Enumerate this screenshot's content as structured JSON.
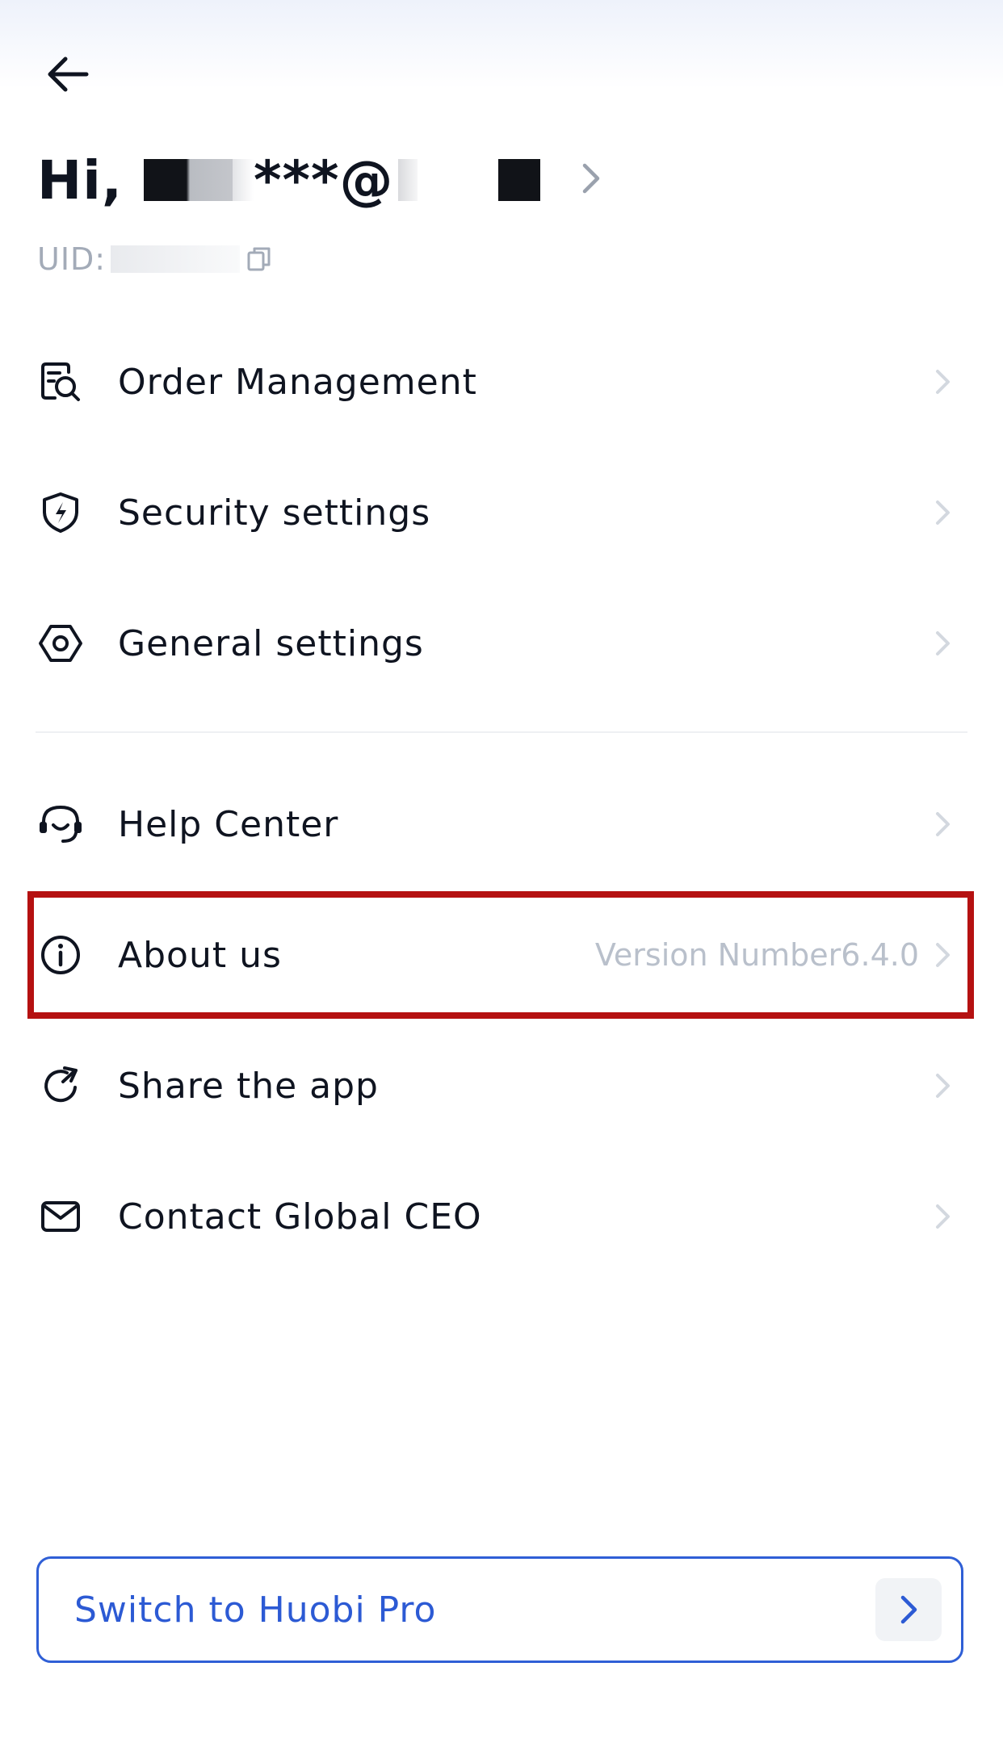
{
  "header": {
    "back_icon": "arrow-left-icon"
  },
  "profile": {
    "greeting_prefix": "Hi,",
    "email_visible": "***@",
    "uid_label": "UID:",
    "copy_icon": "copy-icon",
    "chevron_icon": "chevron-right-icon"
  },
  "menu": {
    "items": [
      {
        "label": "Order Management",
        "icon": "order-search-icon"
      },
      {
        "label": "Security settings",
        "icon": "shield-bolt-icon"
      },
      {
        "label": "General settings",
        "icon": "hexagon-gear-icon"
      },
      {
        "label": "Help Center",
        "icon": "headset-icon"
      },
      {
        "label": "About us",
        "icon": "info-circle-icon",
        "extra": "Version Number6.4.0"
      },
      {
        "label": "Share the app",
        "icon": "share-refresh-icon"
      },
      {
        "label": "Contact Global CEO",
        "icon": "mail-icon"
      }
    ]
  },
  "footer": {
    "switch_label": "Switch to Huobi Pro",
    "switch_icon": "chevron-right-icon"
  },
  "colors": {
    "text": "#0f1420",
    "muted": "#a3abb8",
    "accent_blue": "#2c5ad4",
    "highlight_red": "#b51111",
    "divider": "#eef0f3"
  }
}
